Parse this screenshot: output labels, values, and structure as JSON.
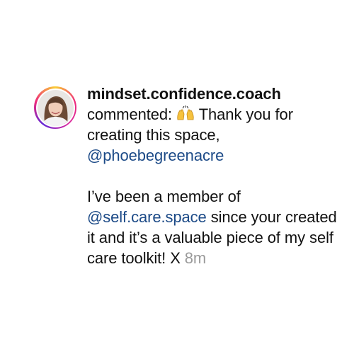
{
  "notification": {
    "username": "mindset.confidence.coach",
    "action": "commented:",
    "emoji_icon": "raising-hands-icon",
    "line1": "Thank you for creating this space,",
    "mention1": "@phoebegreenacre",
    "line2_pre": "I’ve been a member of",
    "mention2": "@self.care.space",
    "line2_post": "since your created it and it’s a valuable piece of my self care toolkit! X",
    "timestamp": "8m"
  },
  "colors": {
    "mention": "#1c4a87",
    "timestamp": "#9a9a9a",
    "text": "#111111"
  }
}
